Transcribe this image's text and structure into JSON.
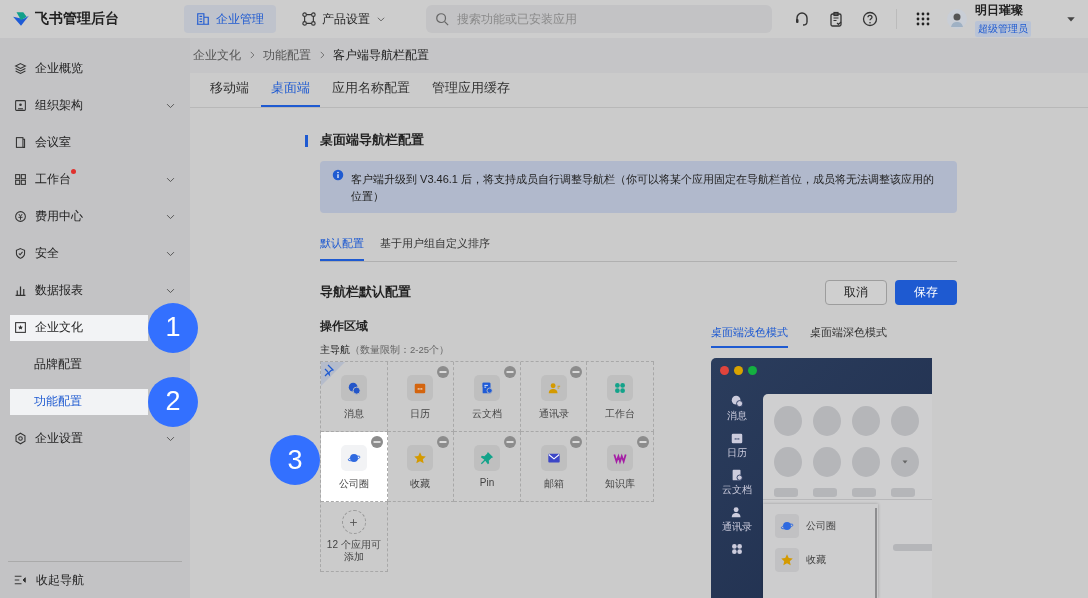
{
  "header": {
    "logo_text": "飞书管理后台",
    "nav": [
      {
        "label": "企业管理",
        "selected": true,
        "caret": false
      },
      {
        "label": "产品设置",
        "selected": false,
        "caret": true
      }
    ],
    "search": {
      "placeholder": "搜索功能或已安装应用"
    },
    "user": {
      "name": "明日璀璨",
      "role": "超级管理员"
    }
  },
  "sidebar": {
    "items": [
      {
        "label": "企业概览",
        "chevron": false,
        "dot": false,
        "highlighted": false,
        "selected": false
      },
      {
        "label": "组织架构",
        "chevron": true,
        "dot": false,
        "highlighted": false,
        "selected": false
      },
      {
        "label": "会议室",
        "chevron": false,
        "dot": false,
        "highlighted": false,
        "selected": false
      },
      {
        "label": "工作台",
        "chevron": true,
        "dot": true,
        "highlighted": false,
        "selected": false
      },
      {
        "label": "费用中心",
        "chevron": true,
        "dot": false,
        "highlighted": false,
        "selected": false
      },
      {
        "label": "安全",
        "chevron": true,
        "dot": false,
        "highlighted": false,
        "selected": false
      },
      {
        "label": "数据报表",
        "chevron": true,
        "dot": false,
        "highlighted": false,
        "selected": false
      },
      {
        "label": "企业文化",
        "chevron": false,
        "dot": false,
        "highlighted": true,
        "selected": false,
        "step": "1",
        "children": [
          {
            "label": "品牌配置",
            "highlighted": false,
            "selected": false
          },
          {
            "label": "功能配置",
            "highlighted": true,
            "selected": true,
            "step": "2"
          }
        ]
      },
      {
        "label": "企业设置",
        "chevron": true,
        "dot": false,
        "highlighted": false,
        "selected": false
      }
    ],
    "footer": "收起导航"
  },
  "breadcrumb": [
    "企业文化",
    "功能配置",
    "客户端导航栏配置"
  ],
  "tabs": [
    {
      "label": "移动端",
      "selected": false
    },
    {
      "label": "桌面端",
      "selected": true
    },
    {
      "label": "应用名称配置",
      "selected": false
    },
    {
      "label": "管理应用缓存",
      "selected": false
    }
  ],
  "section_title": "桌面端导航栏配置",
  "notice": "客户端升级到 V3.46.1 后，将支持成员自行调整导航栏（你可以将某个应用固定在导航栏首位，成员将无法调整该应用的位置）",
  "sub_tabs": [
    {
      "label": "默认配置",
      "selected": true
    },
    {
      "label": "基于用户组自定义排序",
      "selected": false
    }
  ],
  "config": {
    "title": "导航栏默认配置",
    "cancel": "取消",
    "save": "保存",
    "area_title": "操作区域",
    "main_nav_label": "主导航",
    "limit": "（数量限制：2-25个）",
    "apps": [
      {
        "label": "消息",
        "pinned": true,
        "removable": false,
        "highlighted": false
      },
      {
        "label": "日历",
        "pinned": false,
        "removable": true,
        "highlighted": false
      },
      {
        "label": "云文档",
        "pinned": false,
        "removable": true,
        "highlighted": false
      },
      {
        "label": "通讯录",
        "pinned": false,
        "removable": true,
        "highlighted": false
      },
      {
        "label": "工作台",
        "pinned": false,
        "removable": false,
        "highlighted": false
      },
      {
        "label": "公司圈",
        "pinned": false,
        "removable": true,
        "highlighted": true,
        "step": "3"
      },
      {
        "label": "收藏",
        "pinned": false,
        "removable": true,
        "highlighted": false
      },
      {
        "label": "Pin",
        "pinned": false,
        "removable": true,
        "highlighted": false
      },
      {
        "label": "邮箱",
        "pinned": false,
        "removable": true,
        "highlighted": false
      },
      {
        "label": "知识库",
        "pinned": false,
        "removable": true,
        "highlighted": false
      }
    ],
    "add_text": "12 个应用可添加"
  },
  "preview": {
    "tabs": [
      {
        "label": "桌面端浅色模式",
        "selected": true
      },
      {
        "label": "桌面端深色模式",
        "selected": false
      }
    ],
    "sidebar": [
      "消息",
      "日历",
      "云文档",
      "通讯录"
    ],
    "menu": [
      "公司圈",
      "收藏"
    ]
  }
}
